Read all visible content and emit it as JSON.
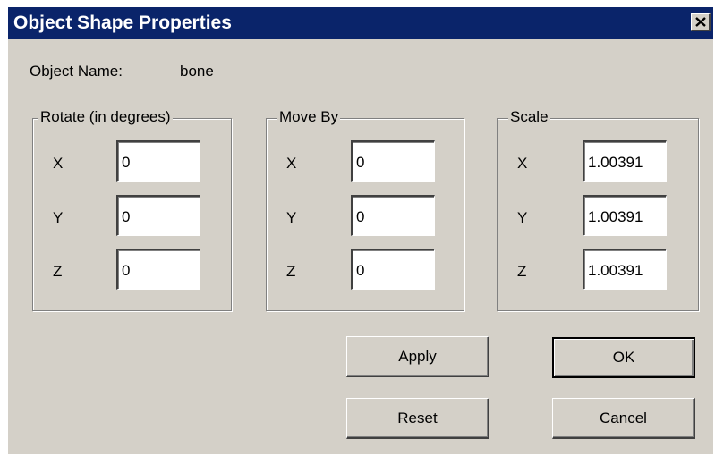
{
  "window": {
    "title": "Object Shape Properties",
    "close_icon": "close-icon",
    "close_glyph": "✕"
  },
  "object": {
    "name_label": "Object Name:",
    "name_value": "bone"
  },
  "rotate": {
    "legend": "Rotate (in degrees)",
    "x_label": "X",
    "y_label": "Y",
    "z_label": "Z",
    "x": "0",
    "y": "0",
    "z": "0"
  },
  "move": {
    "legend": "Move By",
    "x_label": "X",
    "y_label": "Y",
    "z_label": "Z",
    "x": "0",
    "y": "0",
    "z": "0"
  },
  "scale": {
    "legend": "Scale",
    "x_label": "X",
    "y_label": "Y",
    "z_label": "Z",
    "x": "1.00391",
    "y": "1.00391",
    "z": "1.00391"
  },
  "buttons": {
    "apply": "Apply",
    "ok": "OK",
    "reset": "Reset",
    "cancel": "Cancel"
  },
  "colors": {
    "title_bar": "#0a246a",
    "dialog_face": "#d4d0c8"
  }
}
